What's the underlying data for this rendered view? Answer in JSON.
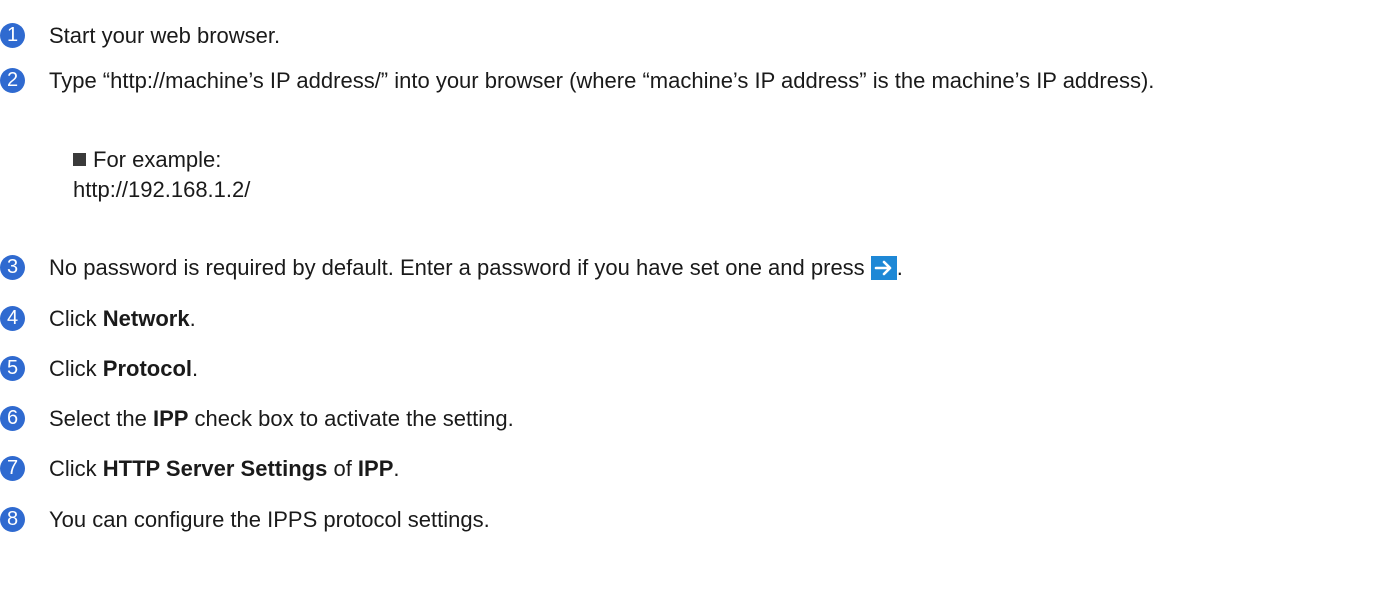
{
  "steps": [
    {
      "number": "1",
      "text": "Start your web browser."
    },
    {
      "number": "2",
      "text": "Type “http://machine’s IP address/” into your browser (where “machine’s IP address” is the machine’s IP address)."
    },
    {
      "number": "3",
      "text": "No password is required by default. Enter a password if you have set one and press",
      "end": "."
    },
    {
      "number": "4",
      "text_prefix": "Click ",
      "bold": "Network",
      "text_suffix": "."
    },
    {
      "number": "5",
      "text_prefix": "Click ",
      "bold": "Protocol",
      "text_suffix": "."
    },
    {
      "number": "6",
      "text_prefix": "Select the ",
      "bold": "IPP",
      "text_suffix": " check box to activate the setting."
    },
    {
      "number": "7",
      "text_prefix": "Click ",
      "bold": "HTTP Server Settings",
      "text_mid": " of ",
      "bold2": "IPP",
      "text_suffix": "."
    },
    {
      "number": "8",
      "text": "You can configure the IPPS protocol settings."
    }
  ],
  "example": {
    "label": "For example:",
    "url": "http://192.168.1.2/"
  },
  "colors": {
    "step_badge": "#2f6ad0",
    "go_button": "#1e88d6"
  },
  "icons": {
    "go_button": "arrow-right-icon"
  }
}
